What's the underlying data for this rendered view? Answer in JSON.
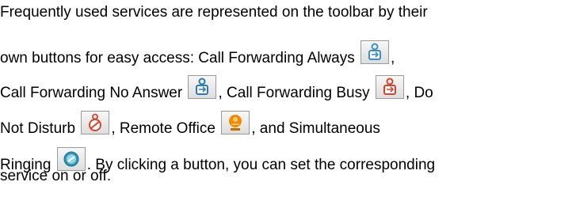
{
  "paragraph": {
    "line1": "Frequently used services are represented on the toolbar by their",
    "line2_a": "own buttons for easy access:  Call Forwarding Always",
    "line2_b": ",",
    "line3_a": "Call Forwarding No Answer",
    "line3_b": ", Call Forwarding Busy",
    "line3_c": ", Do",
    "line4_a": "Not Disturb",
    "line4_b": ", Remote Office",
    "line4_c": ", and Simultaneous",
    "line5_a": "Ringing",
    "line5_b": ".  By clicking a button, you can set the corresponding",
    "line6": "service on or off."
  },
  "icons": {
    "call_forwarding_always": "call-forwarding-always-icon",
    "call_forwarding_no_answer": "call-forwarding-no-answer-icon",
    "call_forwarding_busy": "call-forwarding-busy-icon",
    "do_not_disturb": "do-not-disturb-icon",
    "remote_office": "remote-office-icon",
    "simultaneous_ringing": "simultaneous-ringing-icon"
  },
  "colors": {
    "text": "#000000",
    "forwarding_blue": "#3a8fd0",
    "busy_red": "#d9432b",
    "remote_orange": "#f08a00",
    "ringing_teal": "#2f97b5"
  }
}
